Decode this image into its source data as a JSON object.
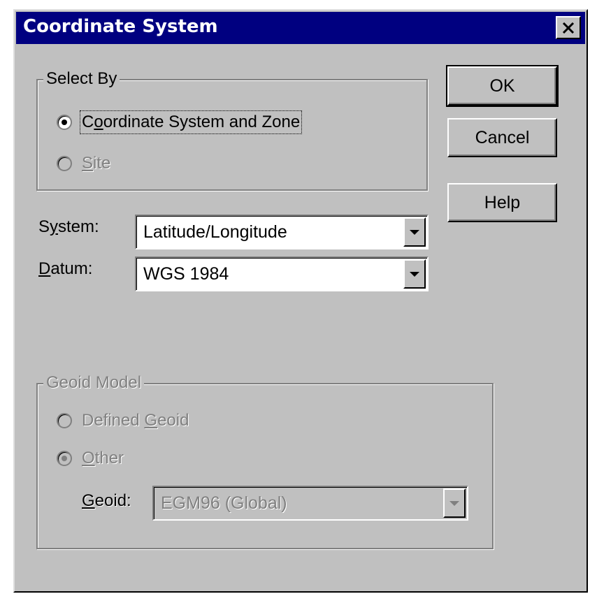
{
  "window": {
    "title": "Coordinate System",
    "close_label": "✕"
  },
  "select_by": {
    "legend": "Select By",
    "options": [
      {
        "prefix": "C",
        "mnemonic": "o",
        "suffix": "ordinate System and Zone",
        "selected": true,
        "enabled": true
      },
      {
        "prefix": "",
        "mnemonic": "S",
        "suffix": "ite",
        "selected": false,
        "enabled": false
      }
    ]
  },
  "system": {
    "label_prefix": "S",
    "label_mnemonic": "y",
    "label_suffix": "stem:",
    "value": "Latitude/Longitude"
  },
  "datum": {
    "label_prefix": "",
    "label_mnemonic": "D",
    "label_suffix": "atum:",
    "value": "WGS 1984"
  },
  "buttons": {
    "ok": "OK",
    "cancel": "Cancel",
    "help": "Help"
  },
  "geoid_model": {
    "legend": "Geoid Model",
    "options": [
      {
        "prefix": "Defined ",
        "mnemonic": "G",
        "suffix": "eoid",
        "selected": false,
        "enabled": false
      },
      {
        "prefix": "",
        "mnemonic": "O",
        "suffix": "ther",
        "selected": true,
        "enabled": false
      }
    ],
    "geoid": {
      "label_prefix": "",
      "label_mnemonic": "G",
      "label_suffix": "eoid:",
      "value": "EGM96 (Global)"
    }
  }
}
